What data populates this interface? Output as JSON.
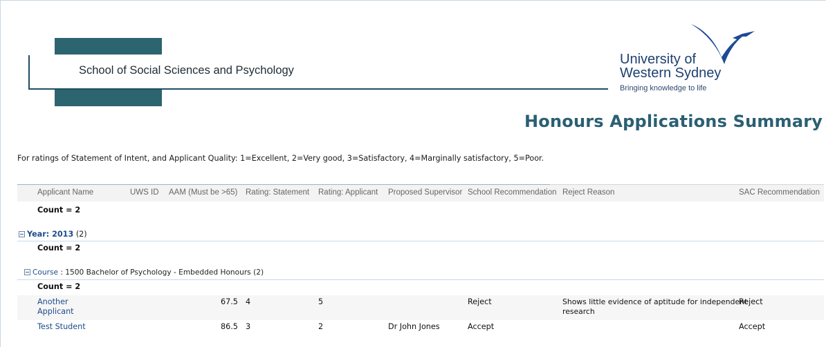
{
  "header": {
    "school_name": "School of Social Sciences and Psychology",
    "university_line1": "University of",
    "university_line2": "Western Sydney",
    "tagline": "Bringing knowledge to life",
    "report_title": "Honours Applications Summary",
    "brand_color": "#2c6470",
    "logo_color": "#1d4a96"
  },
  "note": "For ratings of Statement of Intent, and Applicant Quality: 1=Excellent, 2=Very good, 3=Satisfactory, 4=Marginally satisfactory, 5=Poor.",
  "table": {
    "columns": [
      "Applicant Name",
      "UWS ID",
      "AAM (Must be >65)",
      "Rating: Statement",
      "Rating: Applicant",
      "Proposed Supervisor",
      "School Recommendation",
      "Reject Reason",
      "SAC Recommendation"
    ],
    "count_total": "Count = 2",
    "year_group": {
      "label_prefix": "Year",
      "label_value": ": 2013",
      "count": "(2)",
      "count_line": "Count = 2"
    },
    "course_group": {
      "label_prefix": "Course",
      "label_value": " : 1500 Bachelor of Psychology - Embedded Honours",
      "count": "(2)",
      "count_line": "Count = 2"
    },
    "rows": [
      {
        "name_line1": "Another",
        "name_line2": "Applicant",
        "uws_id": "",
        "aam": "67.5",
        "rating_statement": "4",
        "rating_applicant": "5",
        "supervisor": "",
        "school_rec": "Reject",
        "reject_reason_line1": "Shows little evidence of aptitude for independent",
        "reject_reason_line2": "research",
        "sac_rec": "Reject"
      },
      {
        "name_line1": "Test Student",
        "name_line2": "",
        "uws_id": "",
        "aam": "86.5",
        "rating_statement": "3",
        "rating_applicant": "2",
        "supervisor": "Dr John Jones",
        "school_rec": "Accept",
        "reject_reason_line1": "",
        "reject_reason_line2": "",
        "sac_rec": "Accept"
      }
    ]
  }
}
